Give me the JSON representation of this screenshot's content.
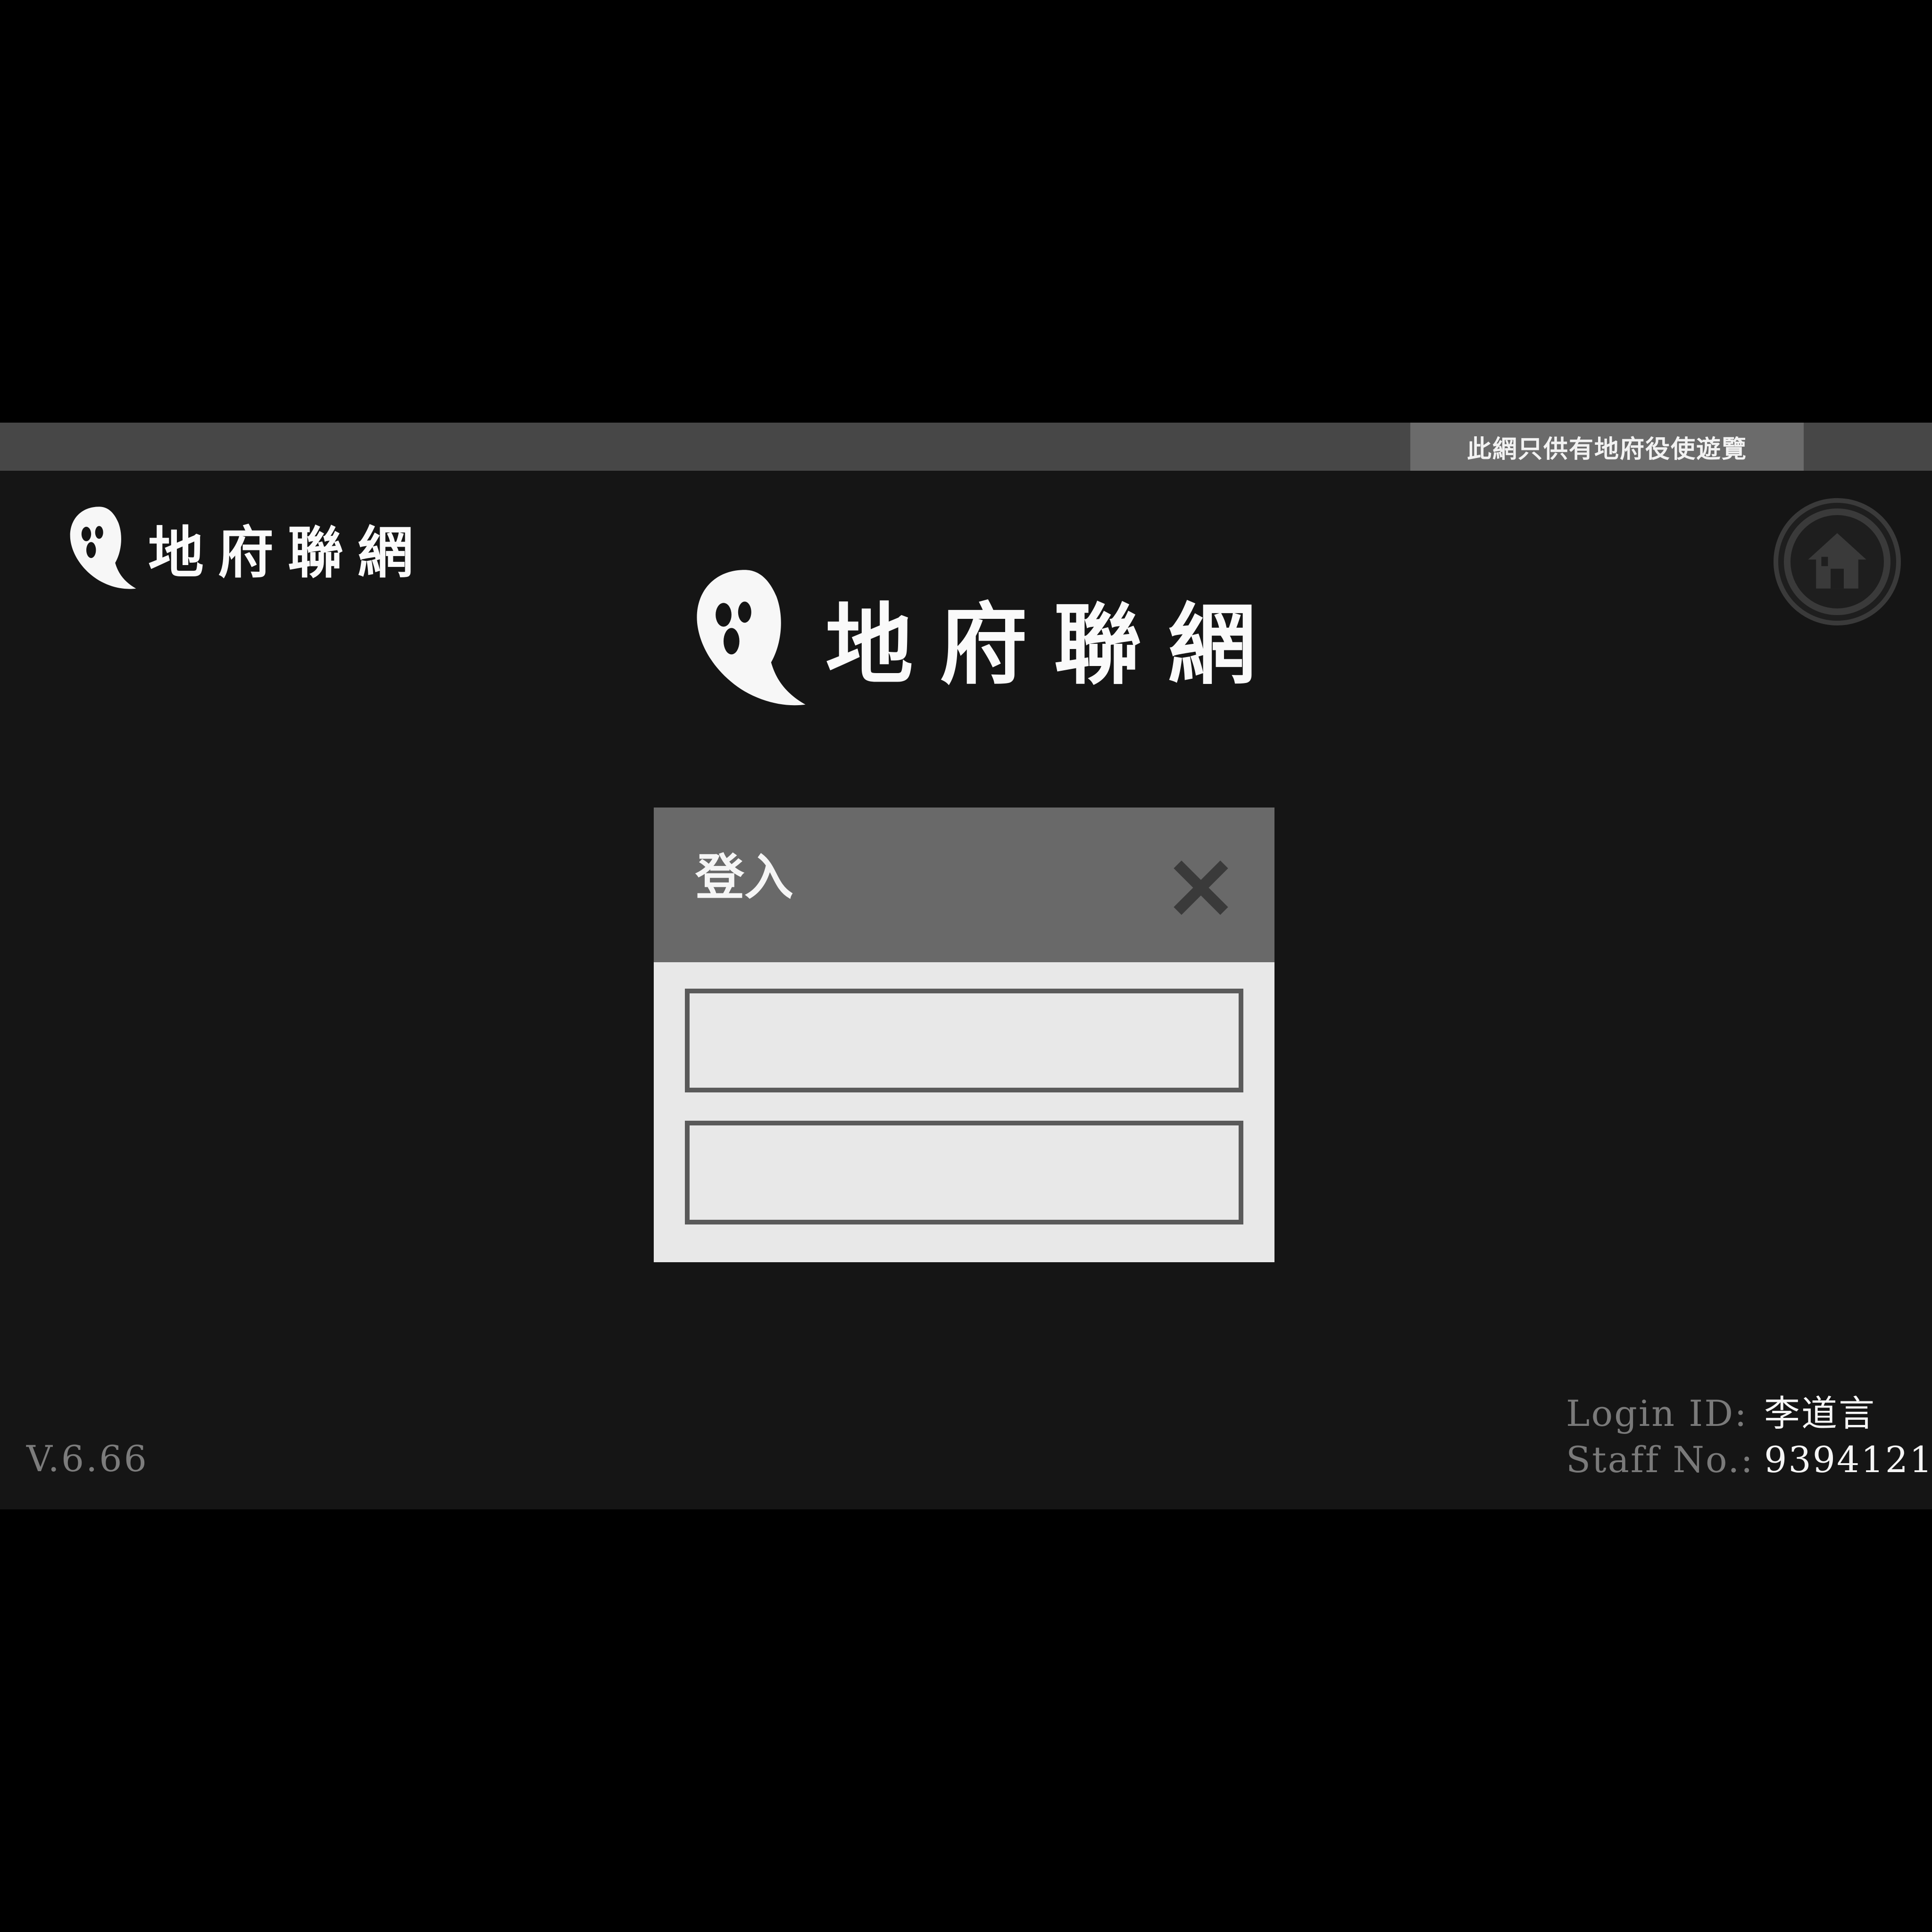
{
  "banner": {
    "notice": "此網只供有地府役使遊覽"
  },
  "logo": {
    "text": "地府聯網"
  },
  "dialog": {
    "title": "登入",
    "username_value": "",
    "password_value": ""
  },
  "footer": {
    "version": "V.6.66",
    "login_id_label": "Login ID:",
    "login_id_value": "李道言",
    "staff_no_label": "Staff No.:",
    "staff_no_value": "9394121"
  },
  "icons": {
    "logo": "ghost-icon",
    "home": "home-icon",
    "close": "close-icon"
  },
  "colors": {
    "background": "#151515",
    "top_bar": "#474747",
    "notice_tab": "#6b6b6b",
    "dialog_header": "#696969",
    "dialog_body": "#e8e8e8"
  }
}
